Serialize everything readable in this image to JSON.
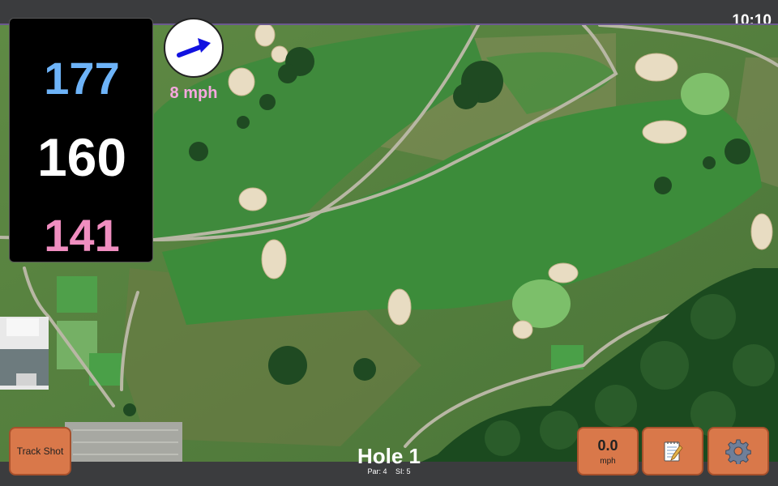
{
  "status": {
    "time": "10:10"
  },
  "distances": {
    "back": "177",
    "middle": "160",
    "front": "141",
    "colors": {
      "back": "#6db3f8",
      "middle": "#ffffff",
      "front": "#f08ec0"
    }
  },
  "wind": {
    "speed_label": "8 mph",
    "speed_color": "#f6a8df",
    "direction_icon": "arrow-icon",
    "arrow_color": "#1212e0"
  },
  "buttons": {
    "track_shot": "Track Shot",
    "speed_value": "0.0",
    "speed_unit": "mph",
    "notes_icon": "notepad-icon",
    "settings_icon": "gear-icon",
    "accent_color": "#d9784a"
  },
  "hole": {
    "title": "Hole 1",
    "par": "Par: 4",
    "si": "SI: 5"
  }
}
